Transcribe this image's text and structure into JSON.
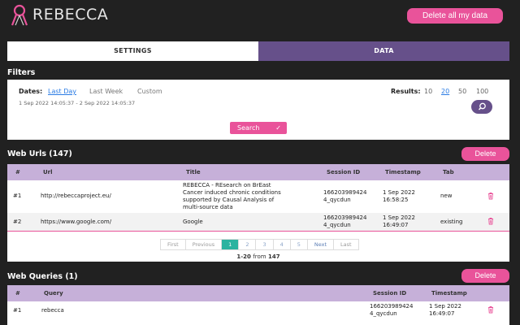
{
  "header": {
    "brand": "REBECCA",
    "delete_all_label": "Delete all my data"
  },
  "tabs": [
    {
      "label": "SETTINGS",
      "active": false
    },
    {
      "label": "DATA",
      "active": true
    }
  ],
  "filters": {
    "title": "Filters",
    "dates_label": "Dates:",
    "date_options": [
      "Last Day",
      "Last Week",
      "Custom"
    ],
    "active_date": "Last Day",
    "date_range": "1 Sep 2022 14:05:37 - 2 Sep 2022 14:05:37",
    "results_label": "Results:",
    "result_options": [
      "10",
      "20",
      "50",
      "100"
    ],
    "active_result": "20",
    "search_label": "Search"
  },
  "web_urls": {
    "title": "Web Urls (147)",
    "delete_label": "Delete",
    "columns": [
      "#",
      "Url",
      "Title",
      "Session ID",
      "Timestamp",
      "Tab"
    ],
    "rows": [
      {
        "num": "#1",
        "url": "http://rebeccaproject.eu/",
        "title_lines": [
          "REBECCA - REsearch on BrEast",
          "Cancer induced chronic conditions",
          "supported by Causal Analysis of",
          "multi-source data"
        ],
        "session_lines": [
          "166203989424",
          "4_qycdun"
        ],
        "timestamp_lines": [
          "1 Sep 2022",
          "16:58:25"
        ],
        "tab": "new"
      },
      {
        "num": "#2",
        "url": "https://www.google.com/",
        "title_lines": [
          "Google"
        ],
        "session_lines": [
          "166203989424",
          "4_qycdun"
        ],
        "timestamp_lines": [
          "1 Sep 2022",
          "16:49:07"
        ],
        "tab": "existing"
      }
    ],
    "pagination": {
      "first": "First",
      "previous": "Previous",
      "pages": [
        "1",
        "2",
        "3",
        "4",
        "5"
      ],
      "active_page": "1",
      "next": "Next",
      "last": "Last",
      "info_range": "1-20",
      "info_from": "from",
      "info_total": "147"
    }
  },
  "web_queries": {
    "title": "Web Queries (1)",
    "delete_label": "Delete",
    "columns": [
      "#",
      "Query",
      "Session ID",
      "Timestamp"
    ],
    "rows": [
      {
        "num": "#1",
        "query": "rebecca",
        "session_lines": [
          "166203989424",
          "4_qycdun"
        ],
        "timestamp_lines": [
          "1 Sep 2022",
          "16:49:07"
        ]
      }
    ]
  },
  "colors": {
    "background": "#212121",
    "accent_pink": "#e9539a",
    "purple": "#66508a",
    "table_header": "#c6b0d9",
    "active_page": "#2bb3a0",
    "link_blue": "#2a7be4"
  },
  "icons": {
    "logo": "ribbon-logo-icon",
    "search": "search-icon",
    "check": "check-icon",
    "trash": "trash-icon"
  }
}
